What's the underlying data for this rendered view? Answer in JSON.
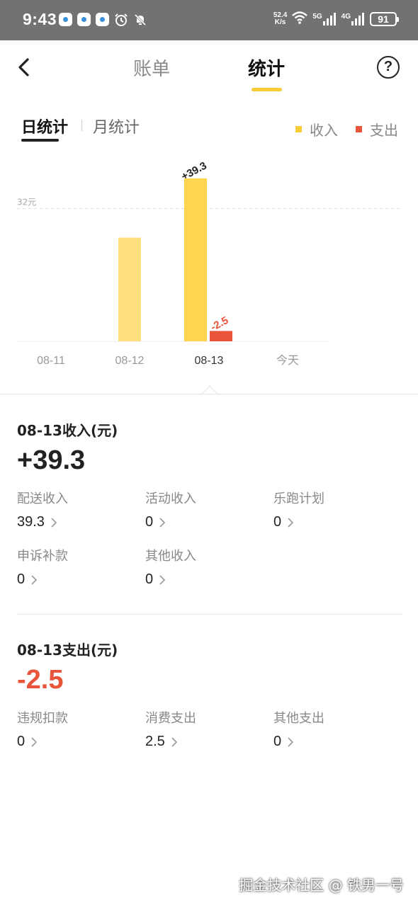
{
  "status_bar": {
    "time": "9:43",
    "net_speed_value": "52.4",
    "net_speed_unit": "K/s",
    "signal_1": "5G",
    "signal_2": "4G",
    "battery": "91"
  },
  "nav": {
    "tab_bills": "账单",
    "tab_stats": "统计",
    "help": "?"
  },
  "sub_tabs": {
    "day": "日统计",
    "month": "月统计"
  },
  "legend": {
    "income": "收入",
    "expense": "支出"
  },
  "colors": {
    "income_bar": "#ffd54f",
    "income_bar_faded": "#ffde7d",
    "expense_bar": "#e8553a",
    "accent": "#f7cc37"
  },
  "chart_data": {
    "type": "bar",
    "categories": [
      "08-11",
      "08-12",
      "08-13",
      "今天"
    ],
    "series": [
      {
        "name": "收入",
        "values": [
          0,
          25,
          39.3,
          0
        ]
      },
      {
        "name": "支出",
        "values": [
          0,
          0,
          2.5,
          0
        ]
      }
    ],
    "reference_line": {
      "value": 32,
      "label": "32元"
    },
    "data_labels": [
      {
        "category": "08-13",
        "series": "收入",
        "text": "+39.3"
      },
      {
        "category": "08-13",
        "series": "支出",
        "text": "-2.5"
      }
    ],
    "ylim": [
      0,
      42
    ],
    "selected_category": "08-13",
    "grid": false
  },
  "income": {
    "title": "08-13收入(元)",
    "total": "+39.3",
    "items": [
      {
        "label": "配送收入",
        "value": "39.3"
      },
      {
        "label": "活动收入",
        "value": "0"
      },
      {
        "label": "乐跑计划",
        "value": "0"
      },
      {
        "label": "申诉补款",
        "value": "0"
      },
      {
        "label": "其他收入",
        "value": "0"
      }
    ]
  },
  "expense": {
    "title": "08-13支出(元)",
    "total": "-2.5",
    "items": [
      {
        "label": "违规扣款",
        "value": "0"
      },
      {
        "label": "消费支出",
        "value": "2.5"
      },
      {
        "label": "其他支出",
        "value": "0"
      }
    ]
  },
  "watermark": "掘金技术社区 @ 铁男一号"
}
